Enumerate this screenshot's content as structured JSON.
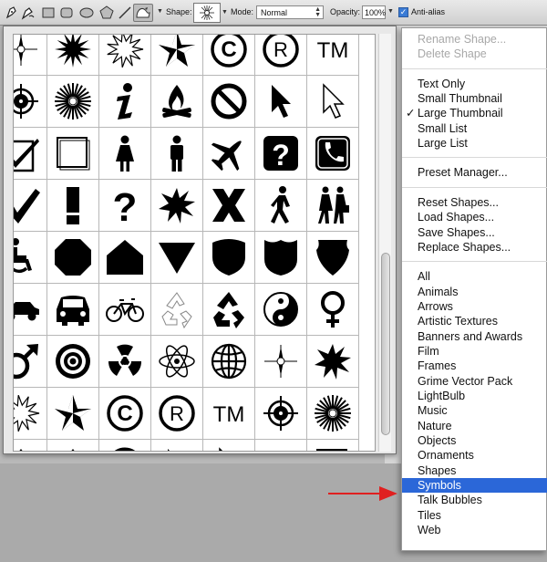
{
  "options_bar": {
    "shape_label": "Shape:",
    "mode_label": "Mode:",
    "mode_value": "Normal",
    "opacity_label": "Opacity:",
    "opacity_value": "100%",
    "antialias_label": "Anti-alias",
    "antialias_checked": true
  },
  "tool_icons": [
    "pen-icon",
    "freeform-pen-icon",
    "rectangle-icon",
    "rounded-rectangle-icon",
    "ellipse-icon",
    "polygon-icon",
    "line-icon",
    "custom-shape-icon"
  ],
  "menu": {
    "groups": [
      [
        {
          "label": "Rename Shape...",
          "disabled": true
        },
        {
          "label": "Delete Shape",
          "disabled": true
        }
      ],
      [
        {
          "label": "Text Only"
        },
        {
          "label": "Small Thumbnail"
        },
        {
          "label": "Large Thumbnail",
          "checked": true
        },
        {
          "label": "Small List"
        },
        {
          "label": "Large List"
        }
      ],
      [
        {
          "label": "Preset Manager..."
        }
      ],
      [
        {
          "label": "Reset Shapes..."
        },
        {
          "label": "Load Shapes..."
        },
        {
          "label": "Save Shapes..."
        },
        {
          "label": "Replace Shapes..."
        }
      ],
      [
        {
          "label": "All"
        },
        {
          "label": "Animals"
        },
        {
          "label": "Arrows"
        },
        {
          "label": "Artistic Textures"
        },
        {
          "label": "Banners and Awards"
        },
        {
          "label": "Film"
        },
        {
          "label": "Frames"
        },
        {
          "label": "Grime Vector Pack"
        },
        {
          "label": "LightBulb"
        },
        {
          "label": "Music"
        },
        {
          "label": "Nature"
        },
        {
          "label": "Objects"
        },
        {
          "label": "Ornaments"
        },
        {
          "label": "Shapes"
        },
        {
          "label": "Symbols",
          "selected": true
        },
        {
          "label": "Talk Bubbles"
        },
        {
          "label": "Tiles"
        },
        {
          "label": "Web"
        }
      ]
    ]
  },
  "grid_shapes": [
    [
      "compass-icon",
      "starburst-icon",
      "starburst-outline-icon",
      "nautical-star-icon",
      "copyright-icon",
      "registered-icon",
      "trademark-icon"
    ],
    [
      "crosshair-icon",
      "radial-burst-icon",
      "info-icon",
      "campfire-icon",
      "no-symbol-icon",
      "cursor-arrow-icon",
      "cursor-arrow-outline-icon"
    ],
    [
      "checkbox-checked-icon",
      "checkbox-empty-icon",
      "female-icon",
      "male-icon",
      "airplane-icon",
      "question-box-icon",
      "telephone-box-icon"
    ],
    [
      "checkmark-icon",
      "exclamation-icon",
      "question-icon",
      "explosion-icon",
      "x-mark-icon",
      "pedestrian-icon",
      "couple-walking-icon"
    ],
    [
      "wheelchair-icon",
      "octagon-icon",
      "pentagon-sign-icon",
      "yield-triangle-icon",
      "shield-icon",
      "highway-shield-icon",
      "badge-shield-icon"
    ],
    [
      "car-side-icon",
      "car-front-icon",
      "bicycle-icon",
      "recycle-outline-icon",
      "recycle-icon",
      "yin-yang-icon",
      "female-symbol-icon"
    ],
    [
      "male-symbol-icon",
      "target-icon",
      "radiation-icon",
      "atom-icon",
      "globe-icon",
      "compass-icon",
      "explosion-icon"
    ],
    [
      "starburst-outline-icon",
      "nautical-star-icon",
      "copyright-icon",
      "registered-icon",
      "trademark-icon",
      "crosshair-icon",
      "radial-burst-icon"
    ],
    [
      "campfire-icon",
      "campfire-icon",
      "no-symbol-icon",
      "cursor-arrow-icon",
      "cursor-arrow-outline-icon",
      "checkbox-checked-icon",
      "checkbox-empty-icon"
    ]
  ]
}
